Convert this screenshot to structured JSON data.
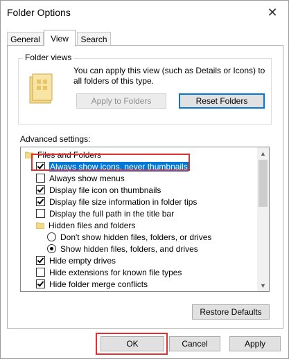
{
  "window": {
    "title": "Folder Options"
  },
  "tabs": [
    {
      "label": "General"
    },
    {
      "label": "View"
    },
    {
      "label": "Search"
    }
  ],
  "folder_views": {
    "label": "Folder views",
    "description": "You can apply this view (such as Details or Icons) to all folders of this type.",
    "apply_button": "Apply to Folders",
    "reset_button": "Reset Folders"
  },
  "advanced": {
    "label": "Advanced settings:",
    "items": [
      {
        "label": "Files and Folders",
        "kind": "folder"
      },
      {
        "label": "Always show icons, never thumbnails",
        "kind": "checkbox",
        "checked": true,
        "selected": true
      },
      {
        "label": "Always show menus",
        "kind": "checkbox",
        "checked": false
      },
      {
        "label": "Display file icon on thumbnails",
        "kind": "checkbox",
        "checked": true
      },
      {
        "label": "Display file size information in folder tips",
        "kind": "checkbox",
        "checked": true
      },
      {
        "label": "Display the full path in the title bar",
        "kind": "checkbox",
        "checked": false
      },
      {
        "label": "Hidden files and folders",
        "kind": "folder"
      },
      {
        "label": "Don't show hidden files, folders, or drives",
        "kind": "radio",
        "checked": false
      },
      {
        "label": "Show hidden files, folders, and drives",
        "kind": "radio",
        "checked": true
      },
      {
        "label": "Hide empty drives",
        "kind": "checkbox",
        "checked": true
      },
      {
        "label": "Hide extensions for known file types",
        "kind": "checkbox",
        "checked": false
      },
      {
        "label": "Hide folder merge conflicts",
        "kind": "checkbox",
        "checked": true
      }
    ]
  },
  "buttons": {
    "restore_defaults": "Restore Defaults",
    "ok": "OK",
    "cancel": "Cancel",
    "apply": "Apply"
  },
  "colors": {
    "highlight": "#0078d7",
    "annotation_red": "#e03030",
    "folder_yellow": "#f4d98b"
  }
}
